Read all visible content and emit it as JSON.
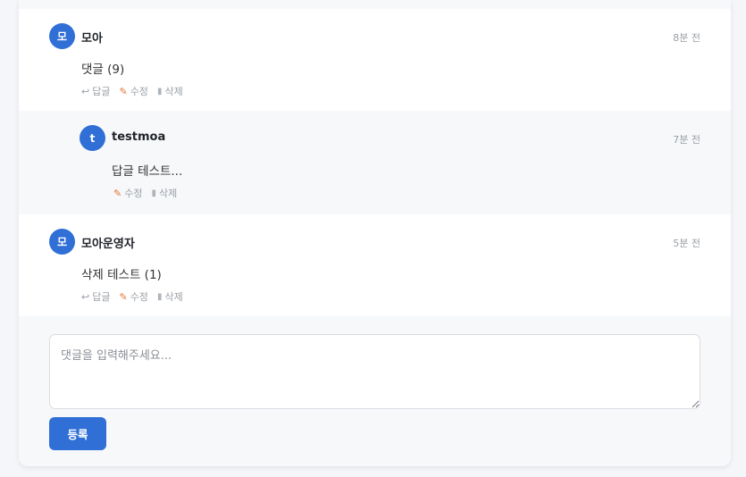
{
  "comments": [
    {
      "avatar": "모",
      "author": "모아",
      "time": "8분 전",
      "text": "댓글 (9)",
      "actions": {
        "reply": "답글",
        "edit": "수정",
        "delete": "삭제"
      }
    },
    {
      "avatar": "t",
      "author": "testmoa",
      "time": "7분 전",
      "text": "답글 테스트...",
      "actions": {
        "edit": "수정",
        "delete": "삭제"
      }
    },
    {
      "avatar": "모",
      "author": "모아운영자",
      "time": "5분 전",
      "text": "삭제 테스트 (1)",
      "actions": {
        "reply": "답글",
        "edit": "수정",
        "delete": "삭제"
      }
    }
  ],
  "form": {
    "placeholder": "댓글을 입력해주세요...",
    "submit_label": "등록"
  },
  "icons": {
    "reply": "reply-arrow-icon",
    "edit": "pencil-icon",
    "delete": "trash-icon"
  },
  "colors": {
    "accent": "#2f6fd6",
    "edit_icon": "#e8743b"
  }
}
